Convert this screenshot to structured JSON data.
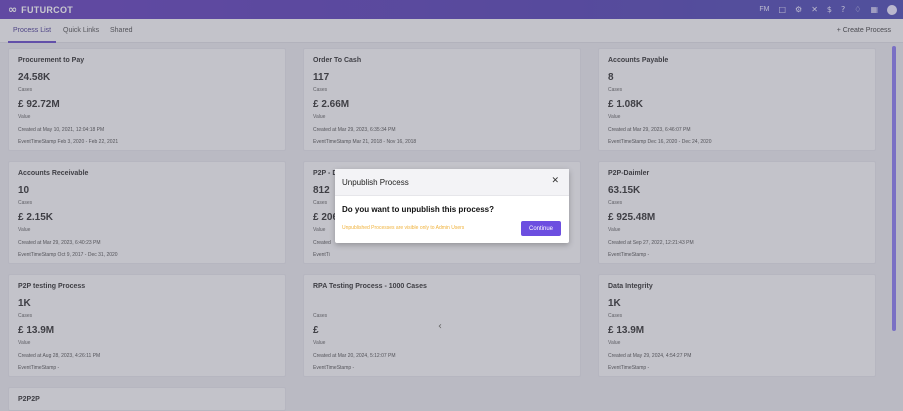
{
  "app": {
    "logo_mark": "∞",
    "name": "FUTURCOT"
  },
  "topbar": {
    "user_initials": "FM",
    "icons": [
      "document-icon",
      "settings-icon",
      "tools-icon",
      "dollar-icon",
      "help-icon",
      "bell-icon",
      "apps-icon",
      "user-icon"
    ]
  },
  "tabs": [
    {
      "label": "Process List",
      "active": true
    },
    {
      "label": "Quick Links",
      "active": false
    },
    {
      "label": "Shared",
      "active": false
    }
  ],
  "create_label": "+ Create Process",
  "cases_label": "Cases",
  "value_label": "Value",
  "cards": [
    {
      "title": "Procurement to Pay",
      "cases": "24.58K",
      "value": "£ 92.72M",
      "created": "Created at May 10, 2021, 12:04:18 PM",
      "event_ts": "EventTimeStamp Feb 3, 2020 - Feb 22, 2021"
    },
    {
      "title": "Order To Cash",
      "cases": "117",
      "value": "£ 2.66M",
      "created": "Created at Mar 29, 2023, 6:35:34 PM",
      "event_ts": "EventTimeStamp Mar 21, 2018 - Nov 16, 2018"
    },
    {
      "title": "Accounts Payable",
      "cases": "8",
      "value": "£ 1.08K",
      "created": "Created at Mar 29, 2023, 6:46:07 PM",
      "event_ts": "EventTimeStamp Dec 16, 2020 - Dec 24, 2020"
    },
    {
      "title": "Accounts Receivable",
      "cases": "10",
      "value": "£ 2.15K",
      "created": "Created at Mar 29, 2023, 6:40:23 PM",
      "event_ts": "EventTimeStamp Oct 9, 2017 - Dec 31, 2020"
    },
    {
      "title": "P2P - D",
      "cases": "812",
      "value": "£ 206",
      "created": "Created",
      "event_ts": "EventTi"
    },
    {
      "title": "P2P-Daimler",
      "cases": "63.15K",
      "value": "£ 925.48M",
      "created": "Created at Sep 27, 2022, 12:21:43 PM",
      "event_ts": "EventTimeStamp -"
    },
    {
      "title": "P2P testing Process",
      "cases": "1K",
      "value": "£ 13.9M",
      "created": "Created at Aug 28, 2023, 4:26:11 PM",
      "event_ts": "EventTimeStamp -"
    },
    {
      "title": "RPA Testing Process - 1000 Cases",
      "cases": "",
      "value": "£",
      "created": "Created at Mar 20, 2024, 5:12:07 PM",
      "event_ts": "EventTimeStamp -"
    },
    {
      "title": "Data Integrity",
      "cases": "1K",
      "value": "£ 13.9M",
      "created": "Created at May 29, 2024, 4:54:27 PM",
      "event_ts": "EventTimeStamp -"
    },
    {
      "title": "P2P2P",
      "cases": "",
      "value": "",
      "created": "",
      "event_ts": ""
    }
  ],
  "carousel_chevron": "‹",
  "modal": {
    "title": "Unpublish Process",
    "close_glyph": "✕",
    "question": "Do you want to unpublish this process?",
    "note": "Unpublished Processes are visible only to Admin Users",
    "continue_label": "Continue"
  }
}
